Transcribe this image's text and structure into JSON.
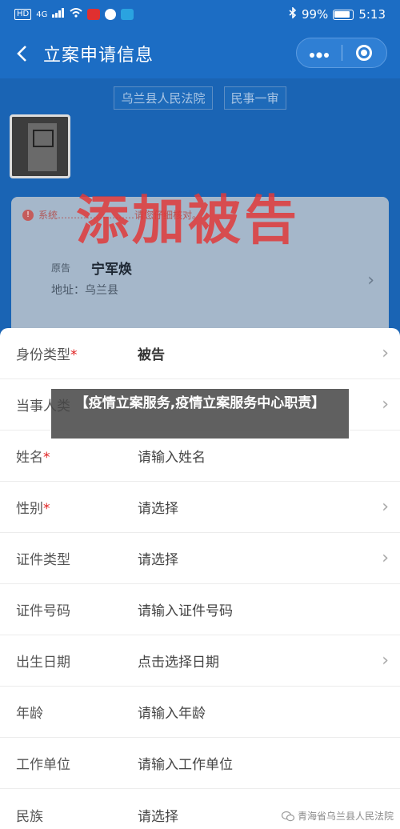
{
  "status_bar": {
    "left_tags": [
      "HD",
      "4G"
    ],
    "battery_pct": "99%",
    "time": "5:13"
  },
  "nav": {
    "title": "立案申请信息",
    "back_icon": "back-chevron-icon",
    "more_icon": "more-dots-icon",
    "close_icon": "target-close-icon"
  },
  "background": {
    "court_tags": [
      "乌兰县人民法院",
      "民事一审"
    ],
    "notice": "系统……………………请您仔细核对。",
    "overlay_title": "添加被告",
    "party": {
      "role": "原告",
      "name": "宁军焕",
      "address": "地址：乌兰县"
    }
  },
  "form": {
    "rows": [
      {
        "label": "身份类型",
        "required": true,
        "value": "被告",
        "chevron": true
      },
      {
        "label": "当事人类",
        "required": false,
        "value": "",
        "chevron": true
      },
      {
        "label": "姓名",
        "required": true,
        "value": "请输入姓名",
        "chevron": false
      },
      {
        "label": "性别",
        "required": true,
        "value": "请选择",
        "chevron": true
      },
      {
        "label": "证件类型",
        "required": false,
        "value": "请选择",
        "chevron": true
      },
      {
        "label": "证件号码",
        "required": false,
        "value": "请输入证件号码",
        "chevron": false
      },
      {
        "label": "出生日期",
        "required": false,
        "value": "点击选择日期",
        "chevron": true
      },
      {
        "label": "年龄",
        "required": false,
        "value": "请输入年龄",
        "chevron": false
      },
      {
        "label": "工作单位",
        "required": false,
        "value": "请输入工作单位",
        "chevron": false
      },
      {
        "label": "民族",
        "required": false,
        "value": "请选择",
        "chevron": false
      }
    ]
  },
  "caption": "【疫情立案服务,疫情立案服务中心职责】",
  "watermark": "青海省乌兰县人民法院",
  "colors": {
    "primary_blue": "#1c6dc4",
    "required_red": "#e02020",
    "overlay_red": "#e03a3a"
  }
}
